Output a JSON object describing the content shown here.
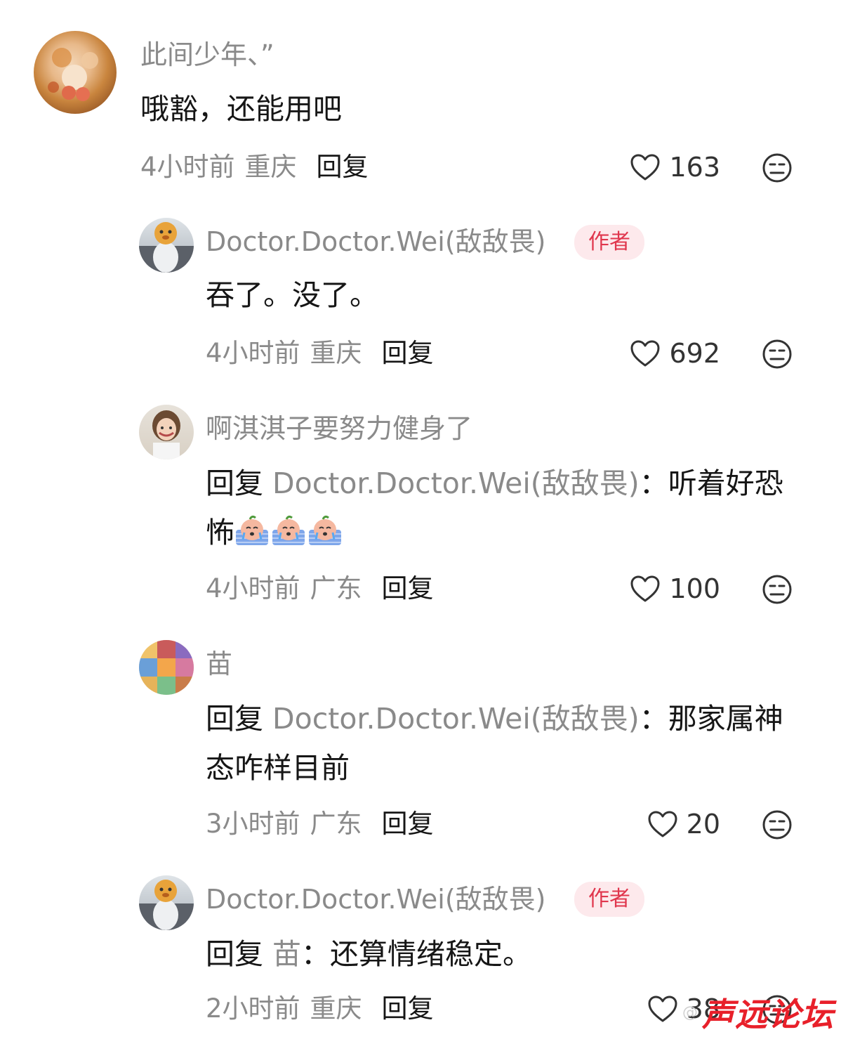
{
  "comments": [
    {
      "nickname": "此间少年、”",
      "content": "哦豁，还能用吧",
      "time": "4小时前",
      "location": "重庆",
      "reply_label": "回复",
      "likes": "163"
    },
    {
      "nickname": "Doctor.Doctor.Wei(敌敌畏)",
      "badge": "作者",
      "content": "吞了。没了。",
      "time": "4小时前",
      "location": "重庆",
      "reply_label": "回复",
      "likes": "692"
    },
    {
      "nickname": "啊淇淇子要努力健身了",
      "reply_prefix": "回复",
      "reply_target": "Doctor.Doctor.Wei(敌敌畏)",
      "colon": "：",
      "content_a": "听着好恐",
      "content_b": "怖",
      "emoji_name": "crying-emoji",
      "time": "4小时前",
      "location": "广东",
      "reply_label": "回复",
      "likes": "100"
    },
    {
      "nickname": "苗",
      "reply_prefix": "回复",
      "reply_target": "Doctor.Doctor.Wei(敌敌畏)",
      "colon": "：",
      "content_a": "那家属神",
      "content_b": "态咋样目前",
      "time": "3小时前",
      "location": "广东",
      "reply_label": "回复",
      "likes": "20"
    },
    {
      "nickname": "Doctor.Doctor.Wei(敌敌畏)",
      "badge": "作者",
      "reply_prefix": "回复",
      "reply_target": "苗",
      "colon": "：",
      "content_a": "还算情绪稳定。",
      "time": "2小时前",
      "location": "重庆",
      "reply_label": "回复",
      "likes": "38"
    }
  ],
  "watermark": {
    "text": "@",
    "logo": "声远论坛"
  },
  "colors": {
    "badge_bg": "#fde9ec",
    "badge_text": "#e0364d",
    "muted": "#8a8a8a",
    "logo": "#e8202a"
  }
}
